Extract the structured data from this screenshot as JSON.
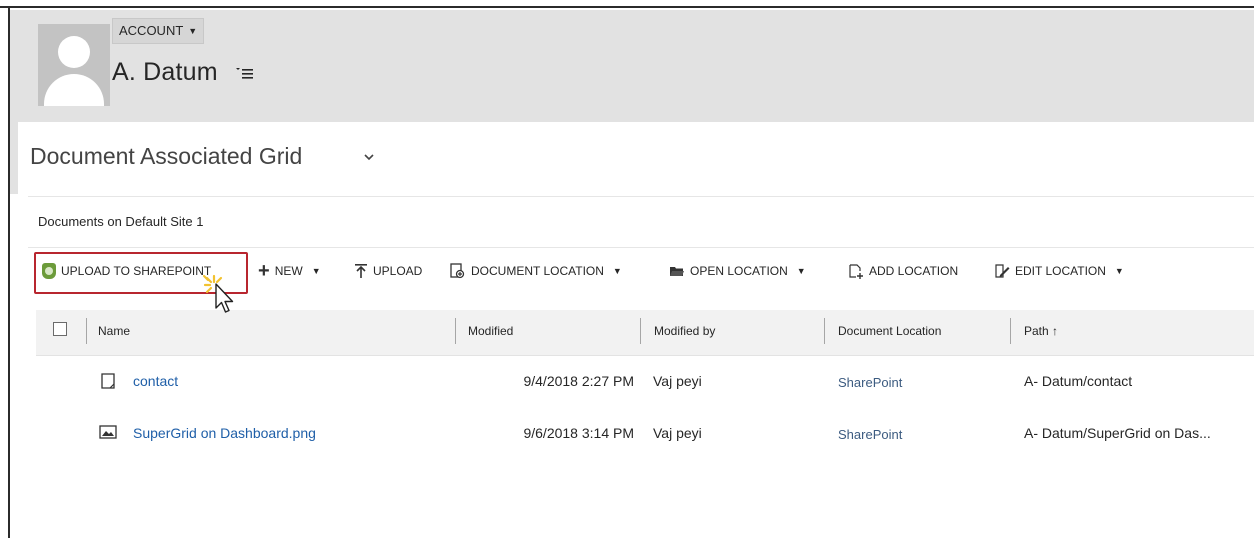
{
  "header": {
    "account_label": "ACCOUNT",
    "record_name": "A. Datum"
  },
  "grid": {
    "title": "Document Associated Grid",
    "documents_label": "Documents on Default Site 1"
  },
  "commands": {
    "upload_sharepoint": "UPLOAD TO SHAREPOINT",
    "new": "NEW",
    "upload": "UPLOAD",
    "document_location": "DOCUMENT LOCATION",
    "open_location": "OPEN LOCATION",
    "add_location": "ADD LOCATION",
    "edit_location": "EDIT LOCATION"
  },
  "table": {
    "columns": [
      "Name",
      "Modified",
      "Modified by",
      "Document Location",
      "Path ↑"
    ],
    "rows": [
      {
        "icon": "document-icon",
        "name": "contact",
        "modified": "9/4/2018 2:27 PM",
        "modified_by": "Vaj peyi",
        "location": "SharePoint",
        "path": "A- Datum/contact"
      },
      {
        "icon": "image-icon",
        "name": "SuperGrid on Dashboard.png",
        "modified": "9/6/2018 3:14 PM",
        "modified_by": "Vaj peyi",
        "location": "SharePoint",
        "path": "A- Datum/SuperGrid on Das..."
      }
    ]
  },
  "colors": {
    "header_bg": "#e2e2e2",
    "link": "#1f5fa8",
    "highlight": "#b8262f"
  }
}
